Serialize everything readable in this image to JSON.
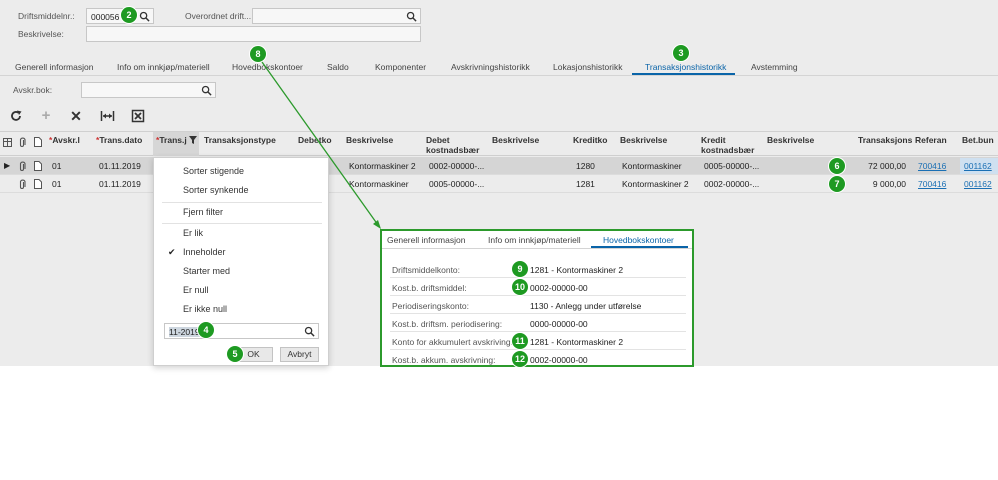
{
  "form": {
    "asset_no_label": "Driftsmiddelnr.:",
    "asset_no_value": "000056",
    "parent_asset_label": "Overordnet drift...",
    "description_label": "Beskrivelse:"
  },
  "tabs": [
    {
      "label": "Generell informasjon"
    },
    {
      "label": "Info om innkjøp/materiell"
    },
    {
      "label": "Hovedbokskontoer"
    },
    {
      "label": "Saldo"
    },
    {
      "label": "Komponenter"
    },
    {
      "label": "Avskrivningshistorikk"
    },
    {
      "label": "Lokasjonshistorikk"
    },
    {
      "label": "Transaksjonshistorikk"
    },
    {
      "label": "Avstemming"
    }
  ],
  "active_tab": "Transaksjonshistorikk",
  "filter": {
    "depr_book_label": "Avskr.bok:"
  },
  "toolbar": {
    "refresh_icon": "refresh-icon",
    "add_icon": "plus-icon",
    "delete_icon": "close-icon",
    "fit_icon": "fit-width-icon",
    "export_icon": "export-excel-icon"
  },
  "columns": {
    "c1": "Avskr.l",
    "c2": "Trans.dato",
    "c3": "Trans.j",
    "c4": "Transaksjonstype",
    "c5": "Debetko",
    "c6": "Beskrivelse",
    "c7a": "Debet",
    "c7b": "kostnadsbær",
    "c8": "Beskrivelse",
    "c9": "Kreditko",
    "c10": "Beskrivelse",
    "c11a": "Kredit",
    "c11b": "kostnadsbær",
    "c12": "Beskrivelse",
    "c13": "Transaksjons",
    "c14": "Referan",
    "c15": "Bet.bun"
  },
  "rows": [
    {
      "book": "01",
      "date": "01.11.2019",
      "debit_desc": "Kontormaskiner 2",
      "debit_sub": "0002-00000-...",
      "credit_acct": "1280",
      "credit_desc": "Kontormaskiner",
      "credit_sub": "0005-00000-...",
      "amount": "72 000,00",
      "ref": "700416",
      "batch": "001162"
    },
    {
      "book": "01",
      "date": "01.11.2019",
      "debit_desc": "Kontormaskiner",
      "debit_sub": "0005-00000-...",
      "credit_acct": "1281",
      "credit_desc": "Kontormaskiner 2",
      "credit_sub": "0002-00000-...",
      "amount": "9 000,00",
      "ref": "700416",
      "batch": "001162"
    }
  ],
  "filter_menu": {
    "items": [
      "Sorter stigende",
      "Sorter synkende",
      "Fjern filter",
      "Er lik",
      "Inneholder",
      "Starter med",
      "Er null",
      "Er ikke null"
    ],
    "selected": "Inneholder",
    "value": "11-2019",
    "ok_label": "OK",
    "cancel_label": "Avbryt"
  },
  "popup": {
    "tabs": [
      "Generell informasjon",
      "Info om innkjøp/materiell",
      "Hovedbokskontoer"
    ],
    "active_tab": "Hovedbokskontoer",
    "fields": [
      {
        "label": "Driftsmiddelkonto:",
        "value": "1281 - Kontormaskiner 2"
      },
      {
        "label": "Kost.b. driftsmiddel:",
        "value": "0002-00000-00"
      },
      {
        "label": "Periodiseringskonto:",
        "value": "1130 - Anlegg under utførelse"
      },
      {
        "label": "Kost.b. driftsm. periodisering:",
        "value": "0000-00000-00"
      },
      {
        "label": "Konto for akkumulert avskriving:",
        "value": "1281 - Kontormaskiner 2"
      },
      {
        "label": "Kost.b. akkum. avskrivning:",
        "value": "0002-00000-00"
      }
    ]
  },
  "markers": [
    "2",
    "3",
    "4",
    "5",
    "6",
    "7",
    "8",
    "9",
    "10",
    "11",
    "12"
  ],
  "colors": {
    "accent": "#0a64a8",
    "marker": "#1e9a22",
    "callout": "#2c9a2c"
  }
}
